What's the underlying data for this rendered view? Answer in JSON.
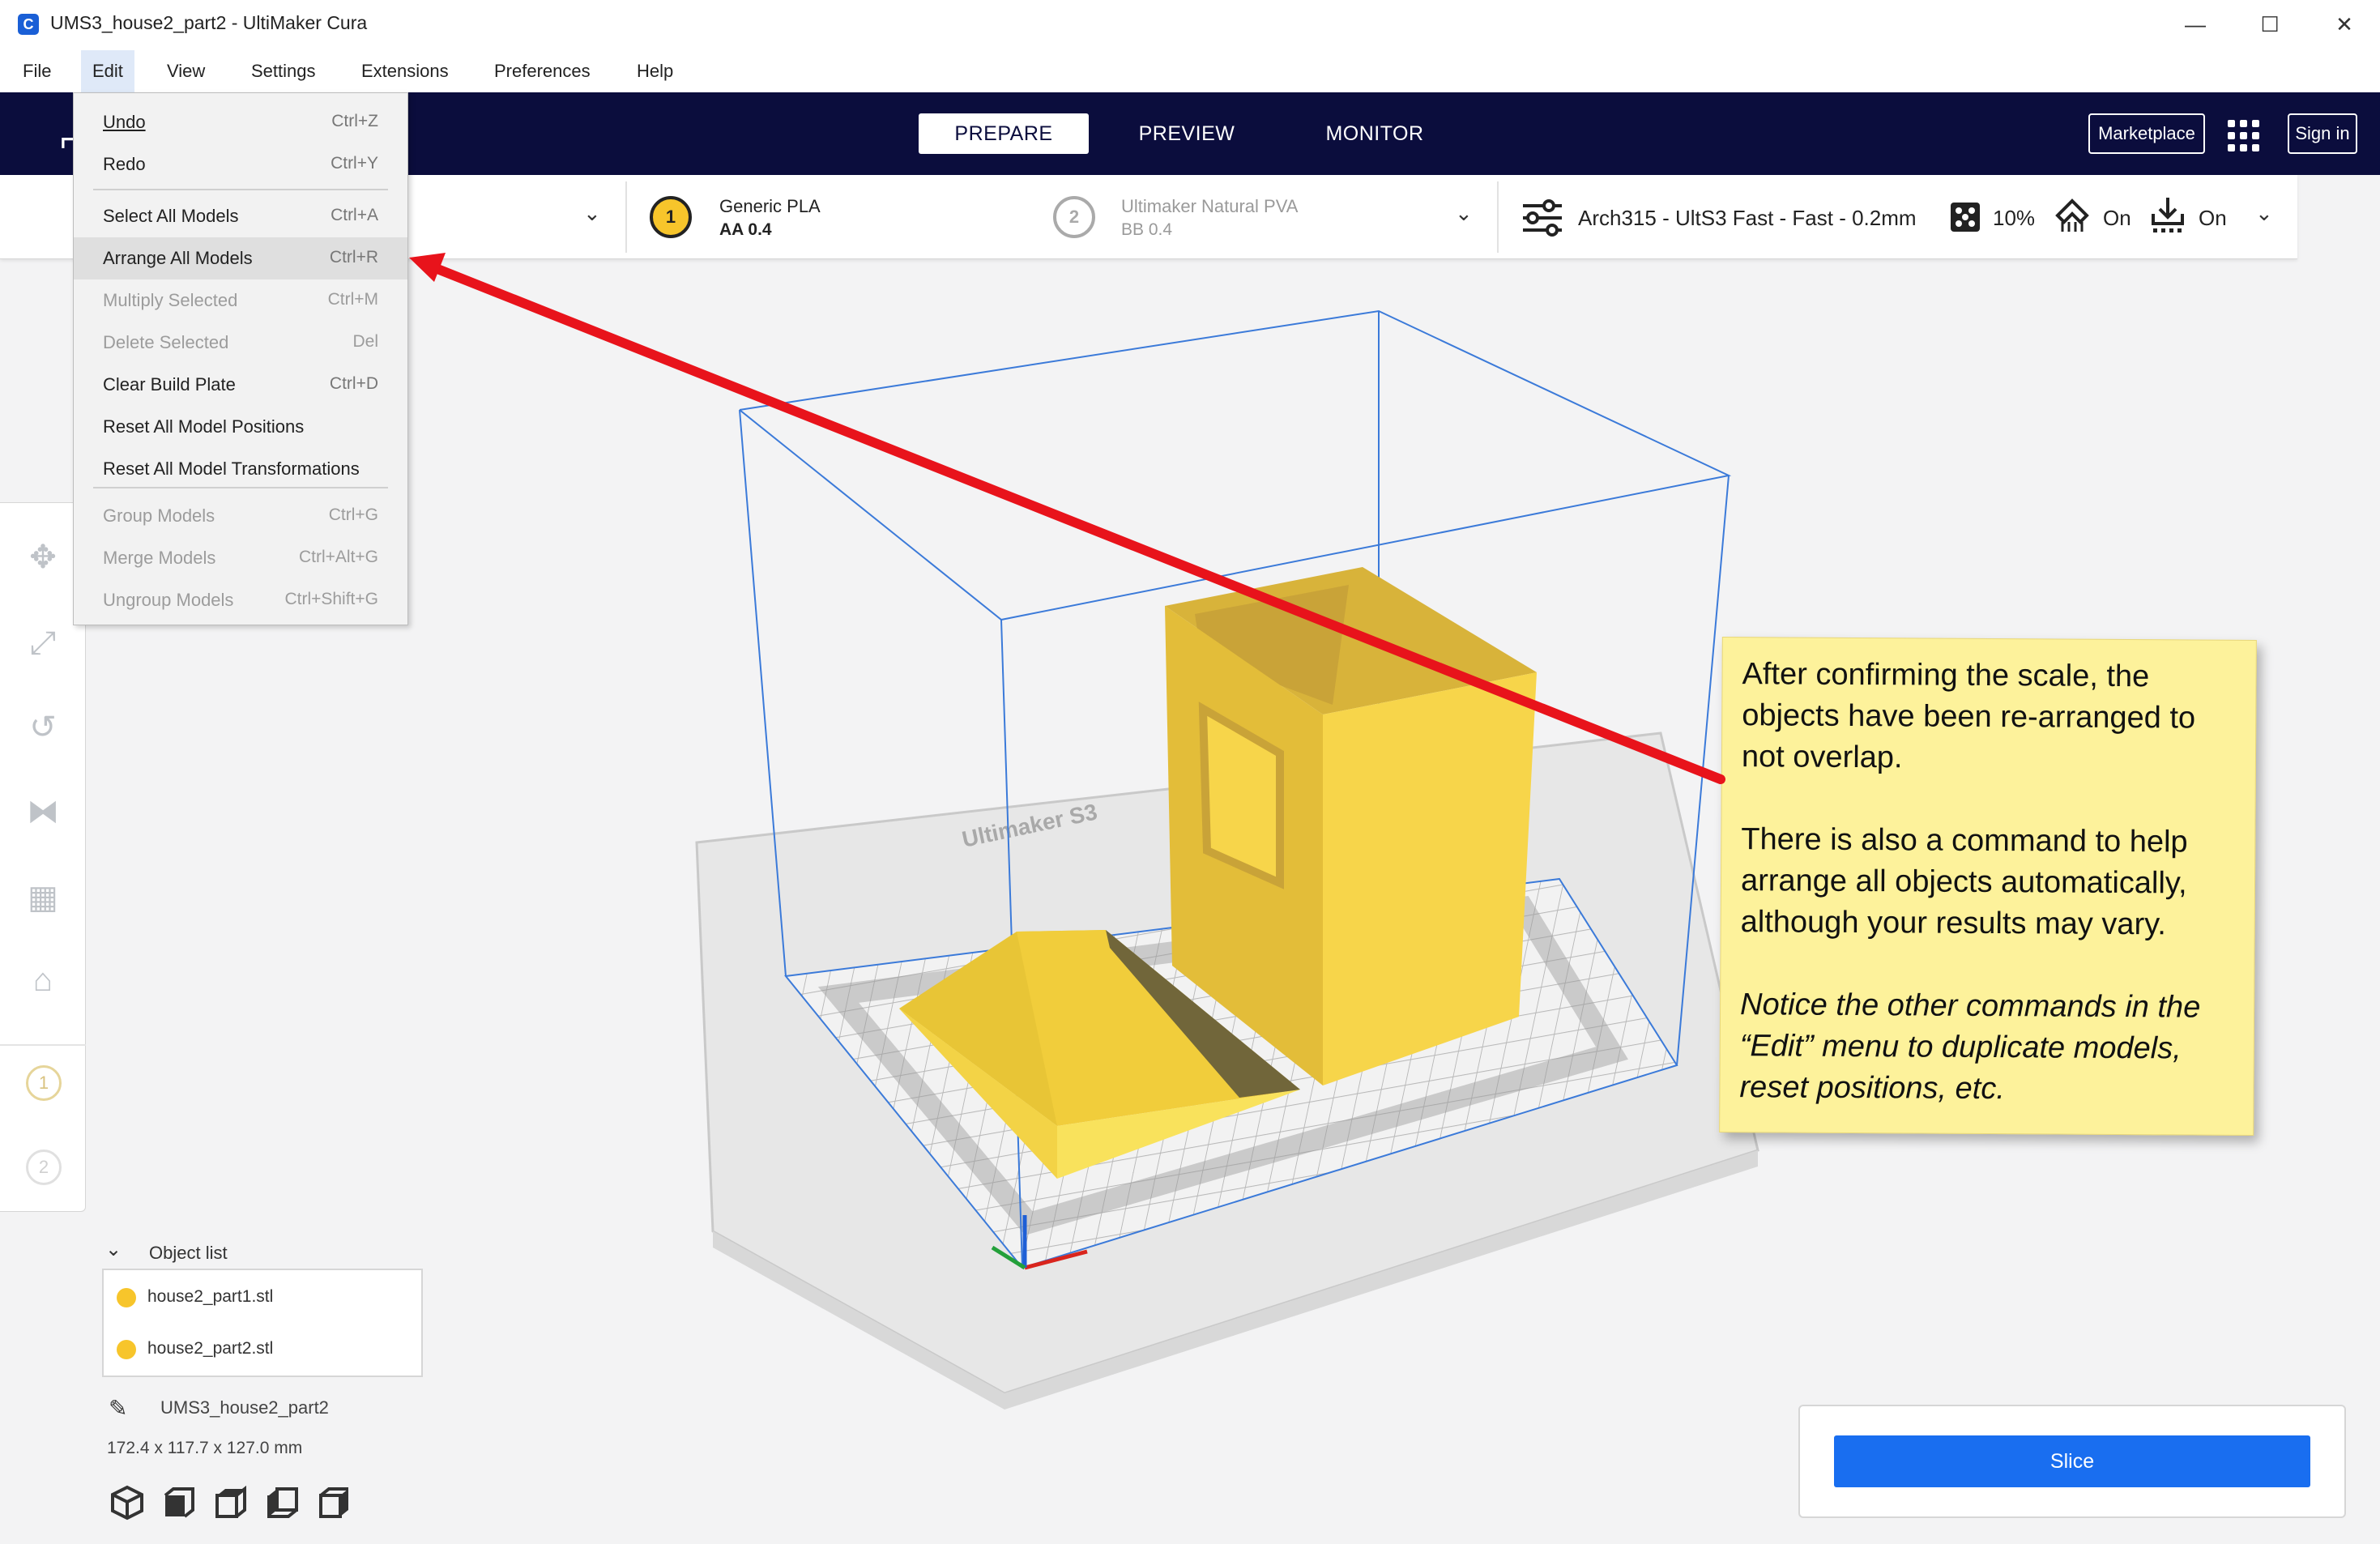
{
  "window": {
    "title": "UMS3_house2_part2 - UltiMaker Cura",
    "app_icon": "C",
    "controls": [
      "—",
      "☐",
      "✕"
    ]
  },
  "menubar": [
    "File",
    "Edit",
    "View",
    "Settings",
    "Extensions",
    "Preferences",
    "Help"
  ],
  "header": {
    "tabs": [
      "PREPARE",
      "PREVIEW",
      "MONITOR"
    ],
    "active_tab": "PREPARE",
    "marketplace": "Marketplace",
    "sign_in": "Sign in"
  },
  "printer_bar": {
    "extruder1": {
      "number": "1",
      "material": "Generic PLA",
      "core": "AA 0.4"
    },
    "extruder2": {
      "number": "2",
      "material": "Ultimaker Natural PVA",
      "core": "BB 0.4"
    },
    "profile": "Arch315 - UltS3 Fast - Fast - 0.2mm",
    "infill": "10%",
    "support": "On",
    "adhesion": "On"
  },
  "edit_menu": {
    "group1": [
      {
        "label": "Undo",
        "shortcut": "Ctrl+Z"
      },
      {
        "label": "Redo",
        "shortcut": "Ctrl+Y"
      }
    ],
    "group2": [
      {
        "label": "Select All Models",
        "shortcut": "Ctrl+A"
      },
      {
        "label": "Arrange All Models",
        "shortcut": "Ctrl+R"
      },
      {
        "label": "Multiply Selected",
        "shortcut": "Ctrl+M"
      },
      {
        "label": "Delete Selected",
        "shortcut": "Del"
      },
      {
        "label": "Clear Build Plate",
        "shortcut": "Ctrl+D"
      },
      {
        "label": "Reset All Model Positions",
        "shortcut": ""
      },
      {
        "label": "Reset All Model Transformations",
        "shortcut": ""
      }
    ],
    "group3": [
      {
        "label": "Group Models",
        "shortcut": "Ctrl+G"
      },
      {
        "label": "Merge Models",
        "shortcut": "Ctrl+Alt+G"
      },
      {
        "label": "Ungroup Models",
        "shortcut": "Ctrl+Shift+G"
      }
    ]
  },
  "object_list": {
    "title": "Object list",
    "items": [
      "house2_part1.stl",
      "house2_part2.stl"
    ],
    "job_name": "UMS3_house2_part2",
    "dimensions": "172.4 x 117.7 x 127.0 mm"
  },
  "build_plate_label": "Ultimaker S3",
  "slice_button": "Slice",
  "annotation": {
    "para1": "After confirming the scale, the objects have been re-arranged to not overlap.",
    "para2": "There is also a command to help arrange all objects automatically, although your results may vary.",
    "para3": "Notice the other commands in the “Edit” menu to duplicate models, reset positions, etc."
  },
  "colors": {
    "header_bg": "#0b0d3d",
    "accent_blue": "#196ef0",
    "model_yellow": "#f7d54a",
    "note_yellow": "#fdf29b",
    "arrow_red": "#e8131b"
  },
  "icons": [
    "move-icon",
    "scale-icon",
    "rotate-icon",
    "mirror-icon",
    "per-model-settings-icon",
    "support-blocker-icon",
    "infill-icon",
    "support-icon",
    "adhesion-icon",
    "settings-sliders-icon",
    "apps-grid-icon",
    "pencil-icon"
  ]
}
